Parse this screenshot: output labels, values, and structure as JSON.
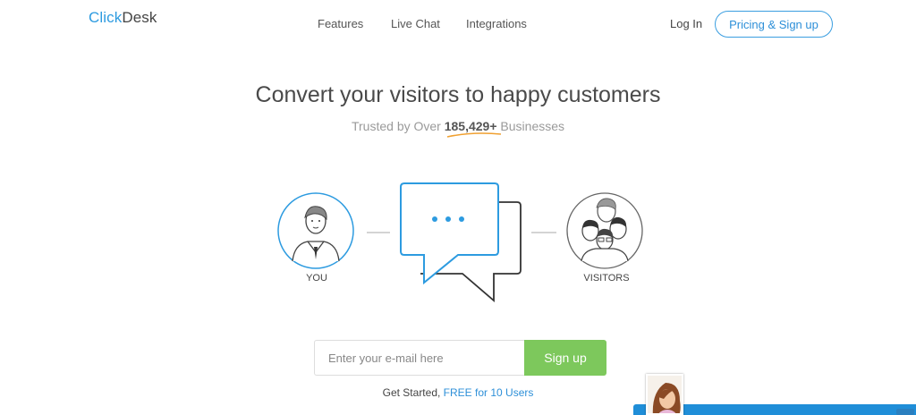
{
  "header": {
    "logo_part1": "Click",
    "logo_part2": "Desk",
    "nav": [
      "Features",
      "Live Chat",
      "Integrations"
    ],
    "login": "Log In",
    "pricing": "Pricing & Sign up"
  },
  "hero": {
    "title": "Convert your visitors to happy customers",
    "trusted_prefix": "Trusted by Over ",
    "trusted_count": "185,429+",
    "trusted_suffix": " Businesses"
  },
  "illustration": {
    "you_label": "YOU",
    "visitors_label": "VISITORS"
  },
  "signup": {
    "placeholder": "Enter your e-mail here",
    "button": "Sign up",
    "note_prefix": "Get Started, ",
    "note_link": "FREE for 10 Users"
  },
  "colors": {
    "accent": "#2d9be0",
    "signup_green": "#7dc85c"
  }
}
